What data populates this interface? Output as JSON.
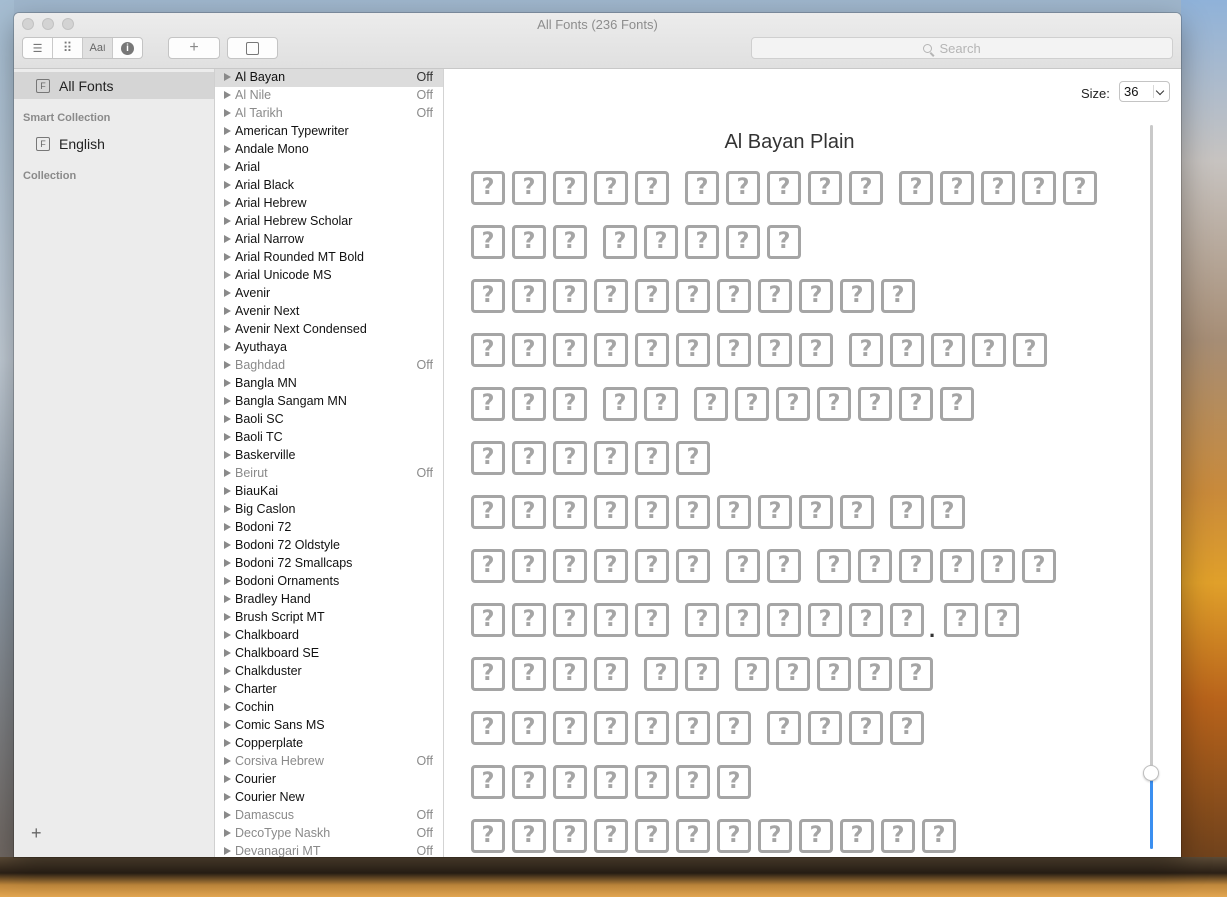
{
  "window": {
    "title": "All Fonts (236 Fonts)"
  },
  "toolbar": {
    "view_buttons": [
      {
        "name": "list-view-button",
        "icon": "list-icon",
        "glyph": "☰"
      },
      {
        "name": "grid-view-button",
        "icon": "grid-icon",
        "glyph": "⠿"
      },
      {
        "name": "sample-view-button",
        "icon": "sample-text-icon",
        "glyph": "AaI"
      },
      {
        "name": "info-view-button",
        "icon": "info-icon",
        "glyph": "i"
      }
    ],
    "add_glyph": "+",
    "search_placeholder": "Search"
  },
  "sidebar": {
    "all_fonts": "All Fonts",
    "smart_collection_header": "Smart Collection",
    "english": "English",
    "collection_header": "Collection",
    "add_glyph": "+"
  },
  "fonts": [
    {
      "name": "Al Bayan",
      "status": "Off",
      "off": false,
      "selected": true
    },
    {
      "name": "Al Nile",
      "status": "Off",
      "off": true
    },
    {
      "name": "Al Tarikh",
      "status": "Off",
      "off": true
    },
    {
      "name": "American Typewriter",
      "status": ""
    },
    {
      "name": "Andale Mono",
      "status": ""
    },
    {
      "name": "Arial",
      "status": ""
    },
    {
      "name": "Arial Black",
      "status": ""
    },
    {
      "name": "Arial Hebrew",
      "status": ""
    },
    {
      "name": "Arial Hebrew Scholar",
      "status": ""
    },
    {
      "name": "Arial Narrow",
      "status": ""
    },
    {
      "name": "Arial Rounded MT Bold",
      "status": ""
    },
    {
      "name": "Arial Unicode MS",
      "status": ""
    },
    {
      "name": "Avenir",
      "status": ""
    },
    {
      "name": "Avenir Next",
      "status": ""
    },
    {
      "name": "Avenir Next Condensed",
      "status": ""
    },
    {
      "name": "Ayuthaya",
      "status": ""
    },
    {
      "name": "Baghdad",
      "status": "Off",
      "off": true
    },
    {
      "name": "Bangla MN",
      "status": ""
    },
    {
      "name": "Bangla Sangam MN",
      "status": ""
    },
    {
      "name": "Baoli SC",
      "status": ""
    },
    {
      "name": "Baoli TC",
      "status": ""
    },
    {
      "name": "Baskerville",
      "status": ""
    },
    {
      "name": "Beirut",
      "status": "Off",
      "off": true
    },
    {
      "name": "BiauKai",
      "status": ""
    },
    {
      "name": "Big Caslon",
      "status": ""
    },
    {
      "name": "Bodoni 72",
      "status": ""
    },
    {
      "name": "Bodoni 72 Oldstyle",
      "status": ""
    },
    {
      "name": "Bodoni 72 Smallcaps",
      "status": ""
    },
    {
      "name": "Bodoni Ornaments",
      "status": ""
    },
    {
      "name": "Bradley Hand",
      "status": ""
    },
    {
      "name": "Brush Script MT",
      "status": ""
    },
    {
      "name": "Chalkboard",
      "status": ""
    },
    {
      "name": "Chalkboard SE",
      "status": ""
    },
    {
      "name": "Chalkduster",
      "status": ""
    },
    {
      "name": "Charter",
      "status": ""
    },
    {
      "name": "Cochin",
      "status": ""
    },
    {
      "name": "Comic Sans MS",
      "status": ""
    },
    {
      "name": "Copperplate",
      "status": ""
    },
    {
      "name": "Corsiva Hebrew",
      "status": "Off",
      "off": true
    },
    {
      "name": "Courier",
      "status": ""
    },
    {
      "name": "Courier New",
      "status": ""
    },
    {
      "name": "Damascus",
      "status": "Off",
      "off": true
    },
    {
      "name": "DecoType Naskh",
      "status": "Off",
      "off": true
    },
    {
      "name": "Devanagari MT",
      "status": "Off",
      "off": true
    }
  ],
  "preview": {
    "size_label": "Size:",
    "size_value": "36",
    "title": "Al Bayan Plain",
    "missing_glyph": "?",
    "dot": ".",
    "lines": [
      [
        5,
        5,
        5
      ],
      [
        3,
        5
      ],
      [
        11
      ],
      [
        9,
        5
      ],
      [
        3,
        2,
        7
      ],
      [
        6
      ],
      [
        10,
        2
      ],
      [
        6,
        2,
        6
      ],
      [
        5,
        6,
        "dot",
        2
      ],
      [
        4,
        2,
        5
      ],
      [
        7,
        4
      ],
      [
        7
      ],
      [
        12
      ]
    ]
  }
}
